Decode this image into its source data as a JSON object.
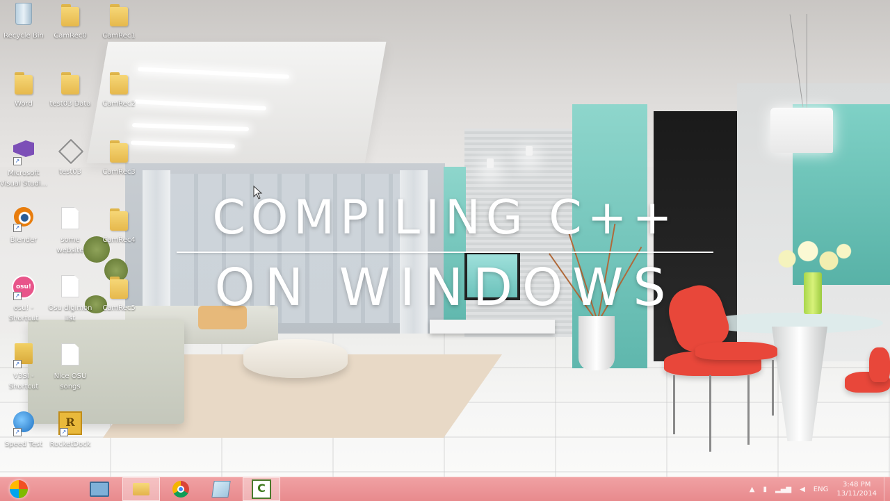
{
  "overlay": {
    "title_line1": "COMPILING C++",
    "title_line2": "ON WINDOWS"
  },
  "desktop": {
    "icons": [
      {
        "label": "Recycle Bin",
        "icon": "recycle-bin-icon"
      },
      {
        "label": "CamRec0",
        "icon": "folder-icon"
      },
      {
        "label": "CamRec1",
        "icon": "folder-icon"
      },
      {
        "label": "Word",
        "icon": "folder-icon"
      },
      {
        "label": "test03 Data",
        "icon": "folder-icon"
      },
      {
        "label": "CamRec2",
        "icon": "folder-icon"
      },
      {
        "label": "Microsoft\nVisual Studi...",
        "icon": "visual-studio-icon"
      },
      {
        "label": "test03",
        "icon": "unity-icon"
      },
      {
        "label": "CamRec3",
        "icon": "folder-icon"
      },
      {
        "label": "Blender",
        "icon": "blender-icon"
      },
      {
        "label": "some\nwebsite",
        "icon": "file-icon"
      },
      {
        "label": "CamRec4",
        "icon": "folder-icon"
      },
      {
        "label": "osu! -\nShortcut",
        "icon": "osu-icon"
      },
      {
        "label": "Osu digimon\nlist",
        "icon": "file-icon"
      },
      {
        "label": "CamRec5",
        "icon": "folder-icon"
      },
      {
        "label": "V3SI -\nShortcut",
        "icon": "shortcut-icon"
      },
      {
        "label": "Nice OSU\nsongs",
        "icon": "file-icon"
      },
      {
        "label": "Speed Test",
        "icon": "speedtest-icon"
      },
      {
        "label": "RocketDock",
        "icon": "rocketdock-icon"
      }
    ]
  },
  "taskbar": {
    "start": "start-orb-icon",
    "pinned": [
      "monitor-icon",
      "file-explorer-icon",
      "chrome-icon",
      "notepad-icon",
      "camtasia-icon"
    ],
    "tray": {
      "language": "ENG",
      "time": "3:48 PM",
      "date": "13/11/2014"
    }
  },
  "colors": {
    "taskbar": "#e88a8d",
    "title_text": "#ffffff"
  }
}
